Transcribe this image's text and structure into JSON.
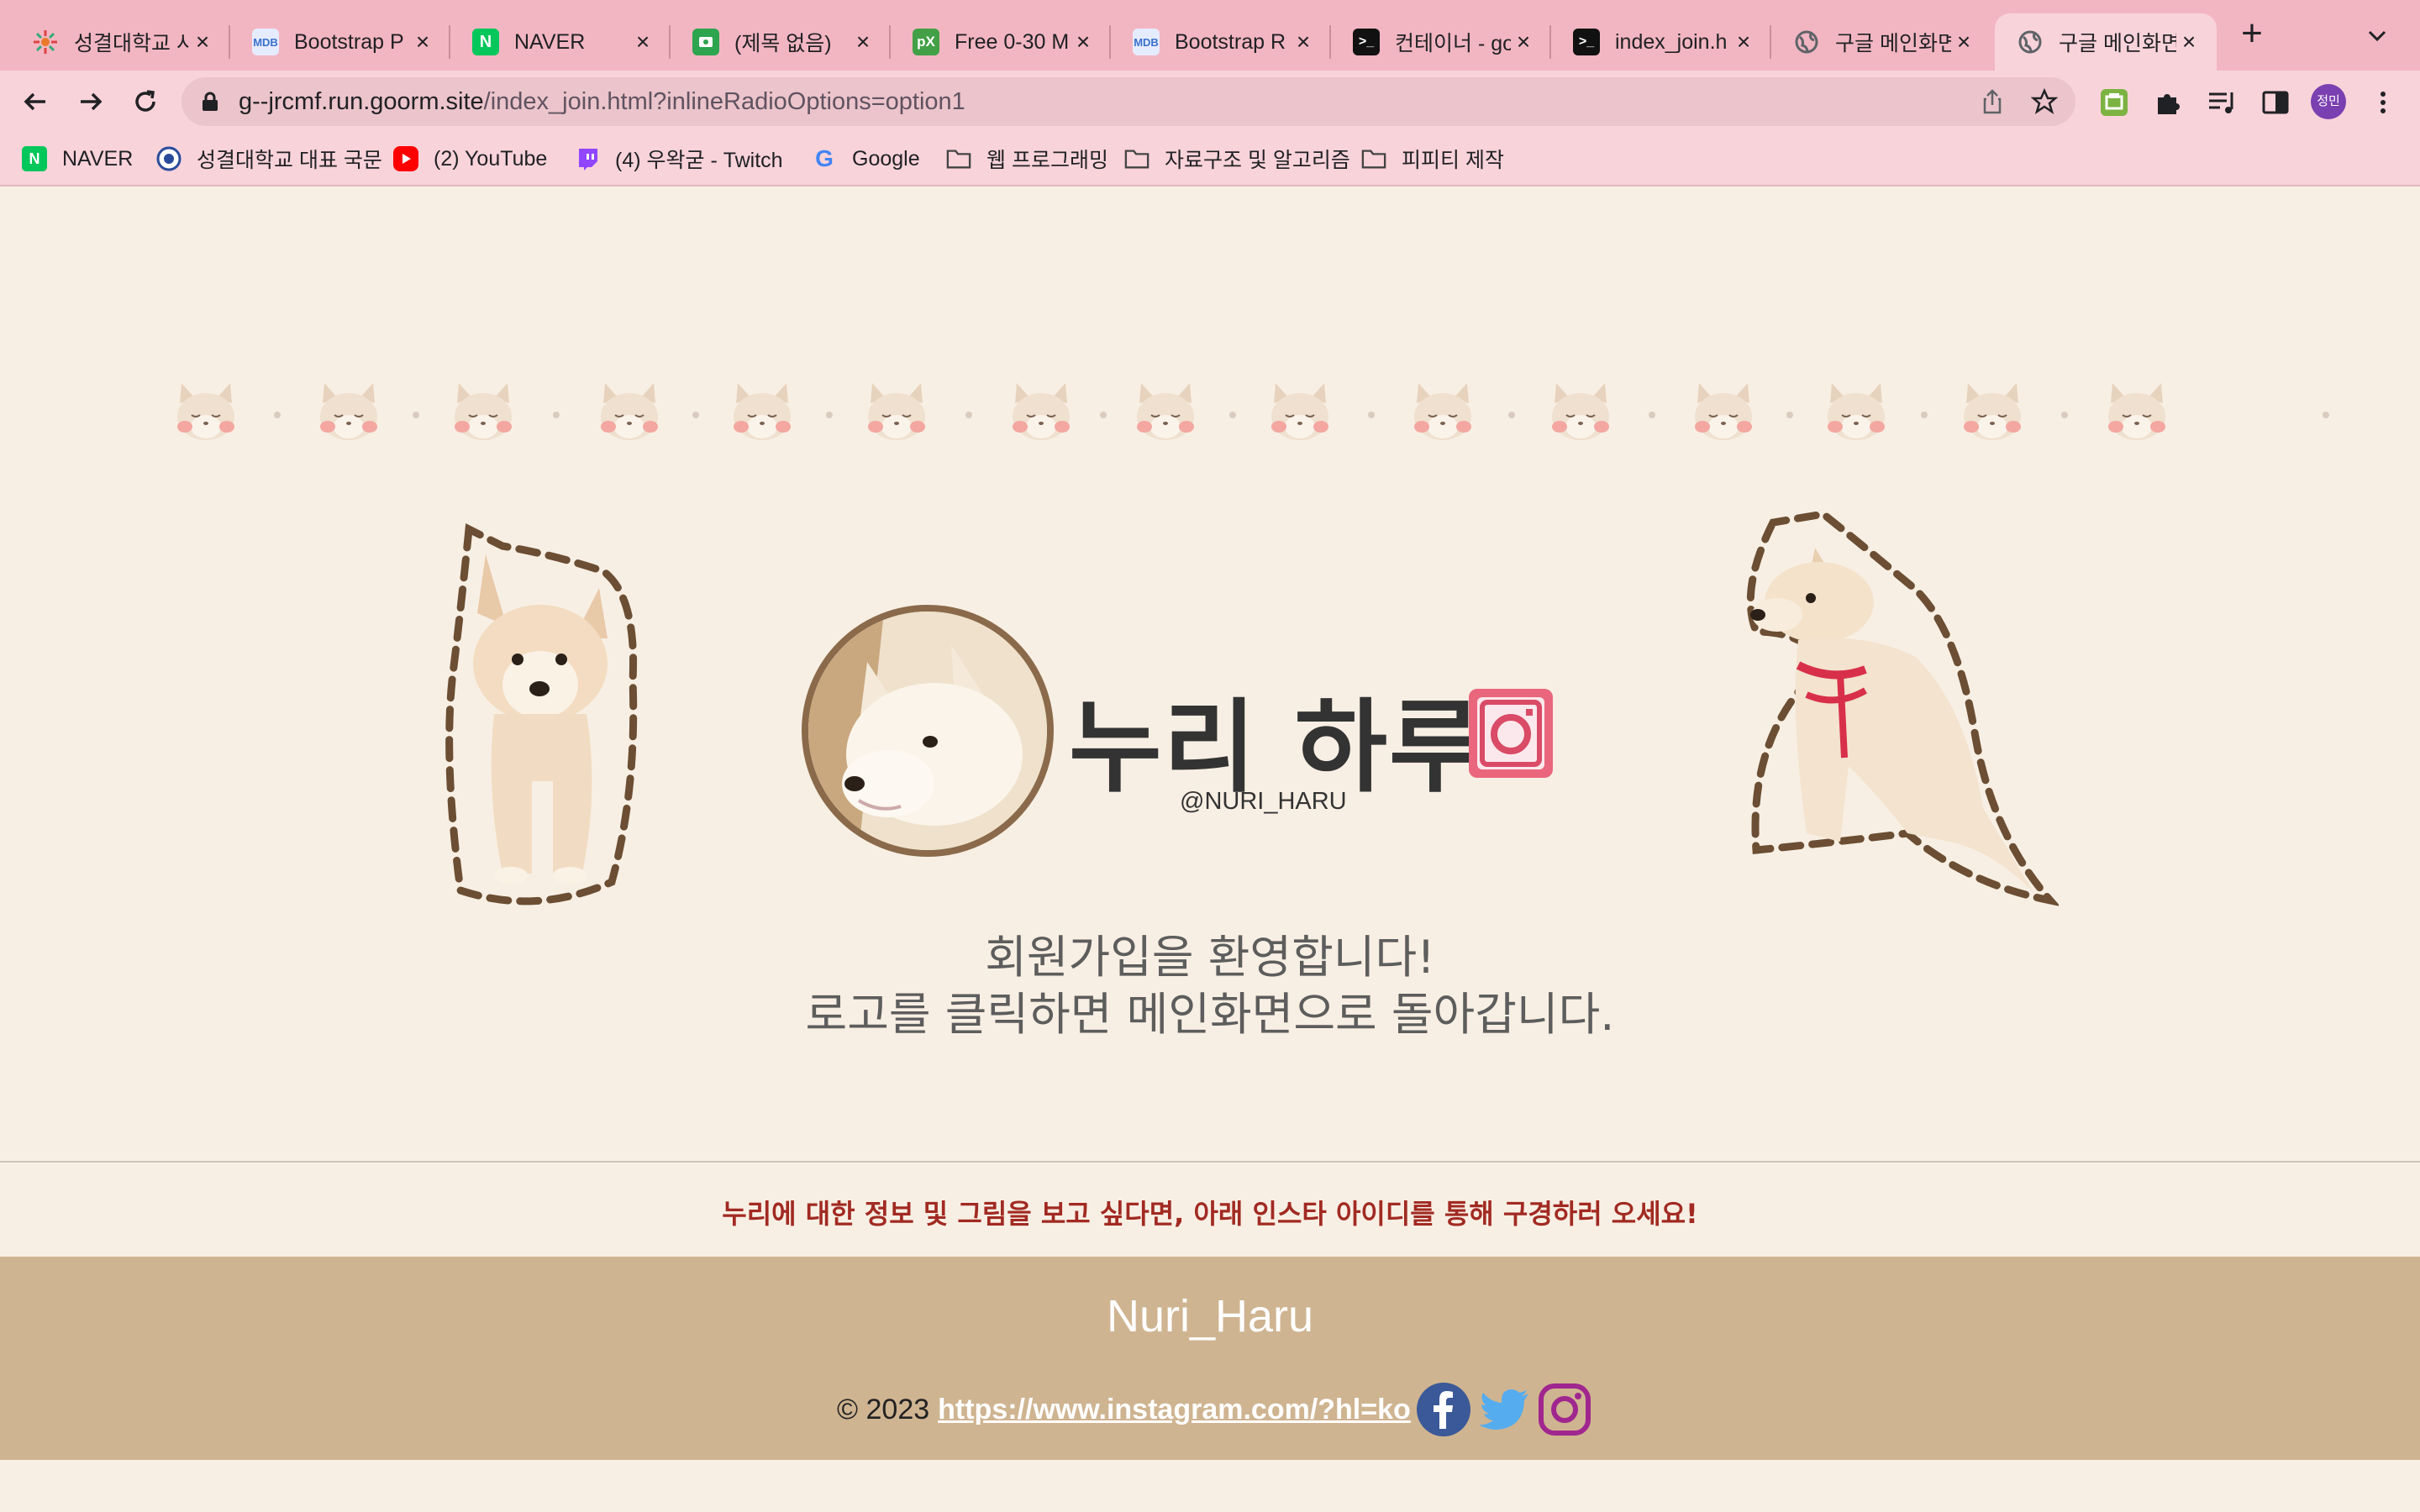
{
  "browser": {
    "tabs": [
      {
        "title": "성결대학교 사",
        "favicon": "sungkyul-icon",
        "color": "#f2b6c2"
      },
      {
        "title": "Bootstrap P",
        "favicon": "mdb-icon",
        "color": "#6ea8ff"
      },
      {
        "title": "NAVER",
        "favicon": "naver-icon",
        "color": "#03c75a"
      },
      {
        "title": "(제목 없음)",
        "favicon": "forms-icon",
        "color": "#2da44e"
      },
      {
        "title": "Free 0-30 M",
        "favicon": "px-icon",
        "color": "#43a047"
      },
      {
        "title": "Bootstrap R",
        "favicon": "mdb-icon",
        "color": "#6ea8ff"
      },
      {
        "title": "컨테이너 - go",
        "favicon": "terminal-icon",
        "color": "#111"
      },
      {
        "title": "index_join.h",
        "favicon": "terminal-icon",
        "color": "#111"
      },
      {
        "title": "구글 메인화면",
        "favicon": "globe-icon",
        "color": "#5f6368"
      },
      {
        "title": "구글 메인화면",
        "favicon": "globe-icon",
        "color": "#5f6368"
      }
    ],
    "active_tab_index": 9,
    "url_host": "g--jrcmf.run.goorm.site",
    "url_path": "/index_join.html?inlineRadioOptions=option1",
    "profile_initials": "정민",
    "bookmarks": [
      {
        "label": "NAVER",
        "icon": "naver-icon"
      },
      {
        "label": "성결대학교 대표 국문",
        "icon": "sungkyul-icon"
      },
      {
        "label": "(2) YouTube",
        "icon": "youtube-icon"
      },
      {
        "label": "(4) 우왁굳 - Twitch",
        "icon": "twitch-icon"
      },
      {
        "label": "Google",
        "icon": "google-icon"
      },
      {
        "label": "웹 프로그래밍",
        "icon": "folder-icon"
      },
      {
        "label": "자료구조 및 알고리즘",
        "icon": "folder-icon"
      },
      {
        "label": "피피티 제작",
        "icon": "folder-icon"
      }
    ]
  },
  "page": {
    "brand_title": "누리 하루",
    "handle": "@NURI_HARU",
    "welcome_line1": "회원가입을 환영합니다!",
    "welcome_line2": "로고를 클릭하면 메인화면으로 돌아갑니다.",
    "notice": "누리에 대한 정보 및 그림을 보고 싶다면, 아래 인스타 아이디를 통해 구경하러 오세요!",
    "footer_title": "Nuri_Haru",
    "copyright": "© 2023",
    "instagram_url": "https://www.instagram.com/?hl=ko"
  },
  "colors": {
    "tabstrip": "#f2b6c2",
    "toolbar": "#f9d3da",
    "page_bg": "#f8efe4",
    "footer_bg": "#cfb491",
    "notice": "#a12a22"
  }
}
